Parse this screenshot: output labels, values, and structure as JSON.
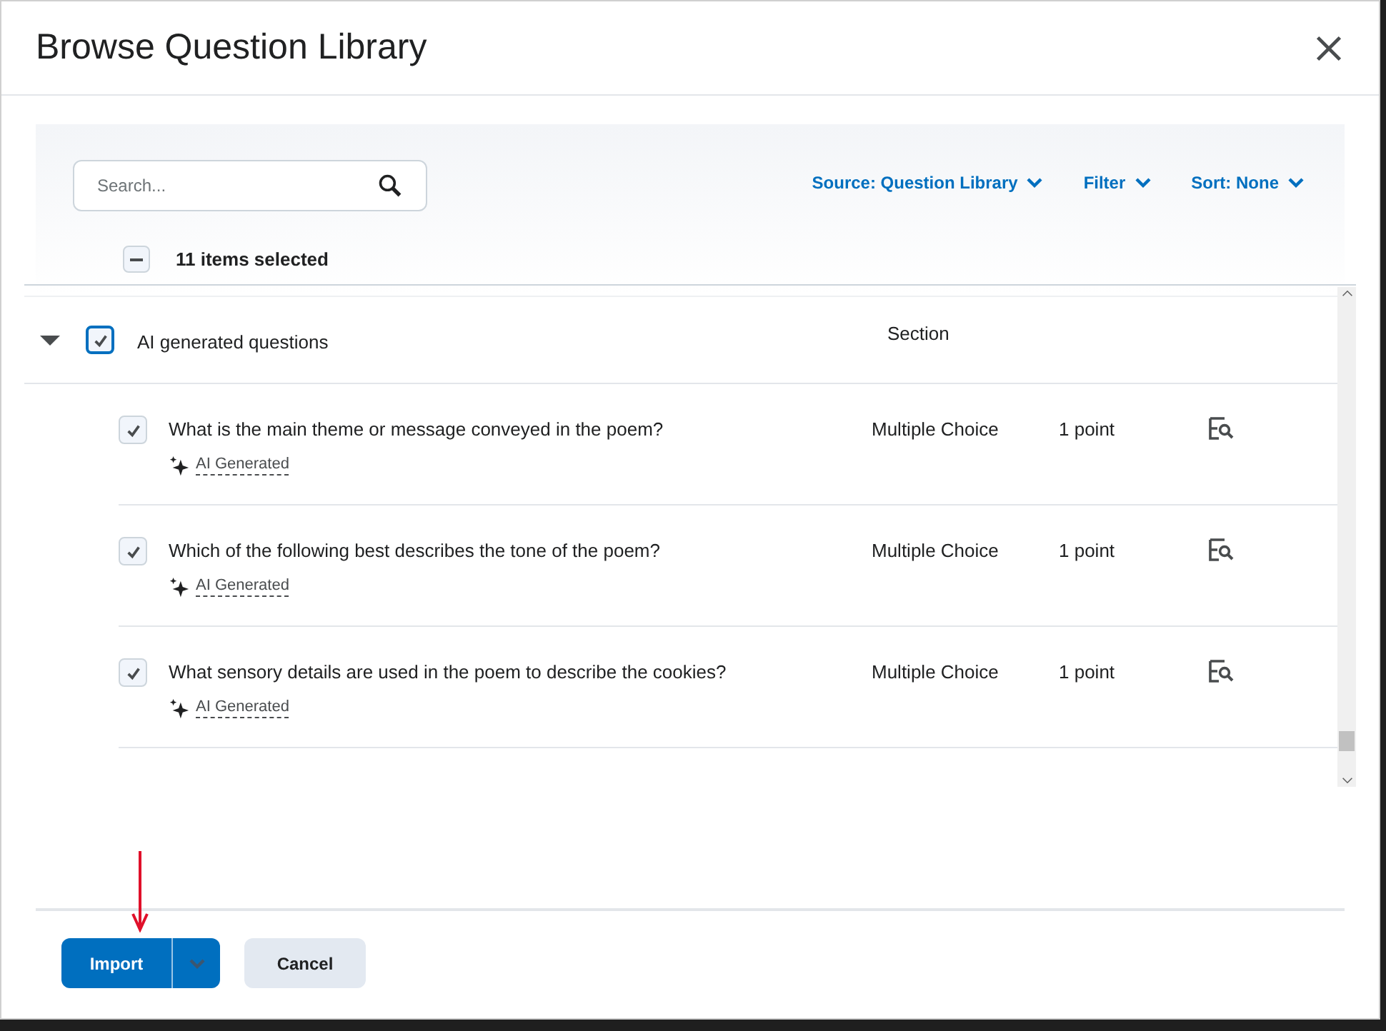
{
  "dialog": {
    "title": "Browse Question Library"
  },
  "search": {
    "placeholder": "Search..."
  },
  "menus": [
    {
      "label": "Source: Question Library"
    },
    {
      "label": "Filter"
    },
    {
      "label": "Sort: None"
    }
  ],
  "selection": {
    "label": "11 items selected",
    "indeterminate": true
  },
  "section": {
    "title": "AI generated questions",
    "type": "Section",
    "expanded": true,
    "checked": true,
    "items": [
      {
        "question": "What is the main theme or message conveyed in the poem?",
        "tag": "AI Generated",
        "type": "Multiple Choice",
        "points": "1 point",
        "checked": true
      },
      {
        "question": "Which of the following best describes the tone of the poem?",
        "tag": "AI Generated",
        "type": "Multiple Choice",
        "points": "1 point",
        "checked": true
      },
      {
        "question": "What sensory details are used in the poem to describe the cookies?",
        "tag": "AI Generated",
        "type": "Multiple Choice",
        "points": "1 point",
        "checked": true
      }
    ]
  },
  "buttons": [
    {
      "label": "Import",
      "kind": "primary"
    },
    {
      "label": "Cancel",
      "kind": "secondary"
    }
  ]
}
